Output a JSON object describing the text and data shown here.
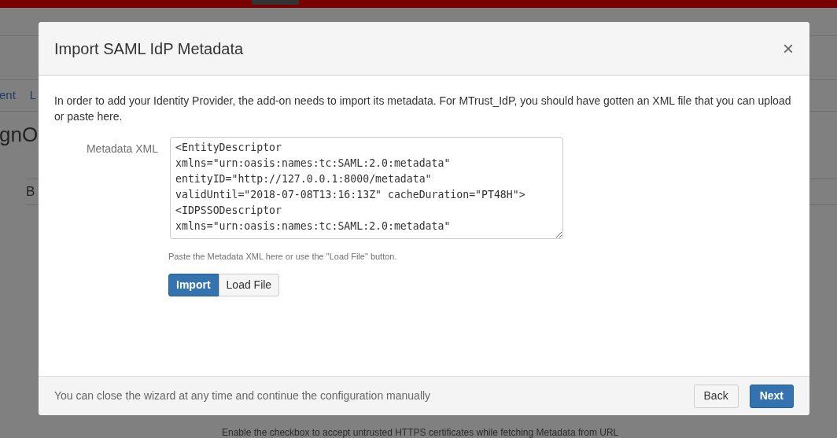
{
  "background_page": {
    "nav_items": [
      "ent",
      "L"
    ],
    "heading": "gnO",
    "section_label": "B",
    "help_lines": [
      "Enable the checkbox to accept untrusted HTTPS certificates while fetching Metadata from URL"
    ]
  },
  "dialog": {
    "title": "Import SAML IdP Metadata",
    "close": "×",
    "intro": "In order to add your Identity Provider, the add-on needs to import its metadata. For MTrust_IdP, you should have gotten an XML file that you can upload or paste here.",
    "field_label": "Metadata XML",
    "xml_value": "<EntityDescriptor\nxmlns=\"urn:oasis:names:tc:SAML:2.0:metadata\"\nentityID=\"http://127.0.0.1:8000/metadata\"\nvalidUntil=\"2018-07-08T13:16:13Z\" cacheDuration=\"PT48H\">\n<IDPSSODescriptor\nxmlns=\"urn:oasis:names:tc:SAML:2.0:metadata\"",
    "hint": "Paste the Metadata XML here or use the \"Load File\" button.",
    "buttons": [
      {
        "label": "Import",
        "kind": "primary"
      },
      {
        "label": "Load File",
        "kind": "default"
      }
    ],
    "footer_text": "You can close the wizard at any time and continue the configuration manually",
    "footer_buttons": [
      {
        "label": "Back",
        "kind": "default"
      },
      {
        "label": "Next",
        "kind": "primary"
      }
    ]
  }
}
